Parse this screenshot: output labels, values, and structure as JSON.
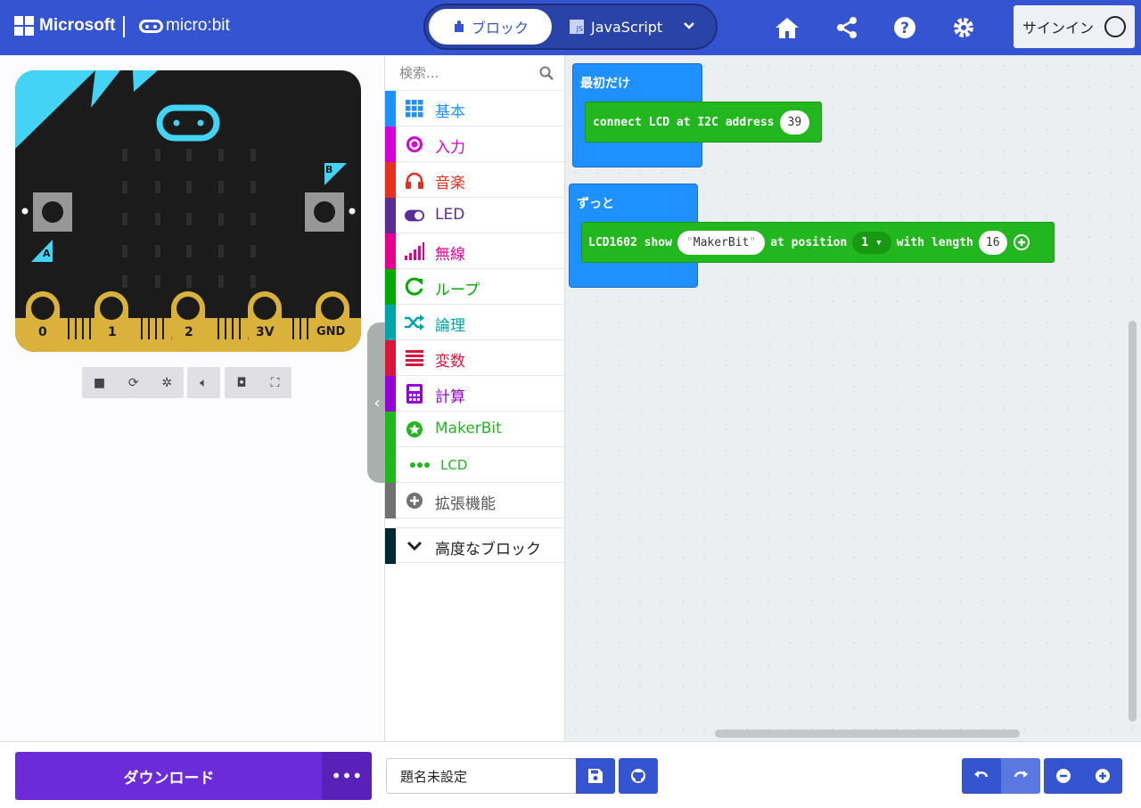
{
  "header": {
    "brand": "Microsoft",
    "product": "micro:bit",
    "tab_blocks": "ブロック",
    "tab_js": "JavaScript",
    "js_badge": "JS",
    "signin": "サインイン"
  },
  "simulator": {
    "pins": [
      "0",
      "1",
      "2",
      "3V",
      "GND"
    ],
    "button_a": "A",
    "button_b": "B"
  },
  "toolbox": {
    "search_placeholder": "検索...",
    "categories": [
      {
        "label": "基本",
        "color": "#1e90ff"
      },
      {
        "label": "入力",
        "color": "#d400d4"
      },
      {
        "label": "音楽",
        "color": "#e63022"
      },
      {
        "label": "LED",
        "color": "#5c2d91"
      },
      {
        "label": "無線",
        "color": "#e3008c"
      },
      {
        "label": "ループ",
        "color": "#00aa00"
      },
      {
        "label": "論理",
        "color": "#00a4a6"
      },
      {
        "label": "変数",
        "color": "#dc143c"
      },
      {
        "label": "計算",
        "color": "#9400d3"
      },
      {
        "label": "MakerBit",
        "color": "#22b61f"
      },
      {
        "label": "LCD",
        "color": "#22b61f"
      },
      {
        "label": "拡張機能",
        "color": "#717171"
      }
    ],
    "advanced": "高度なブロック"
  },
  "workspace": {
    "on_start": "最初だけ",
    "connect_text": "connect LCD at I2C address",
    "address": "39",
    "forever": "ずっと",
    "show_prefix": "LCD1602 show",
    "show_text": "MakerBit",
    "at_position": "at position",
    "position": "1",
    "with_length": "with length",
    "length": "16"
  },
  "footer": {
    "download": "ダウンロード",
    "more": "•••",
    "project_name": "題名未設定"
  }
}
